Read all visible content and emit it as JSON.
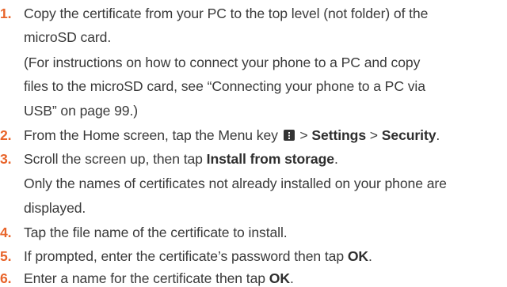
{
  "steps": [
    {
      "number": "1.",
      "lines": [
        "Copy the certificate from your PC to the top level (not folder) of the",
        "microSD card.",
        "(For instructions on how to connect your phone to a PC and copy",
        "files to the microSD card, see “Connecting your phone to a PC via",
        "USB” on page 99.)"
      ]
    },
    {
      "number": "2.",
      "text_before": "From the Home screen, tap the Menu key ",
      "sep1": " > ",
      "settings": "Settings",
      "sep2": " > ",
      "security": "Security",
      "end": "."
    },
    {
      "number": "3.",
      "text_before": "Scroll the screen up, then tap ",
      "bold": "Install from storage",
      "end": ".",
      "lines": [
        "Only the names of certificates not already installed on your phone are",
        "displayed."
      ]
    },
    {
      "number": "4.",
      "text": "Tap the file name of the certificate to install."
    },
    {
      "number": "5.",
      "text_before": "If prompted, enter the certificate’s password then tap ",
      "bold": "OK",
      "end": "."
    },
    {
      "number": "6.",
      "text_before": "Enter a name for the certificate then tap ",
      "bold": "OK",
      "end": "."
    }
  ],
  "icons": {
    "menu_key": "menu-key-icon"
  },
  "colors": {
    "step_number": "#e8642a",
    "text": "#3a3a3a"
  }
}
